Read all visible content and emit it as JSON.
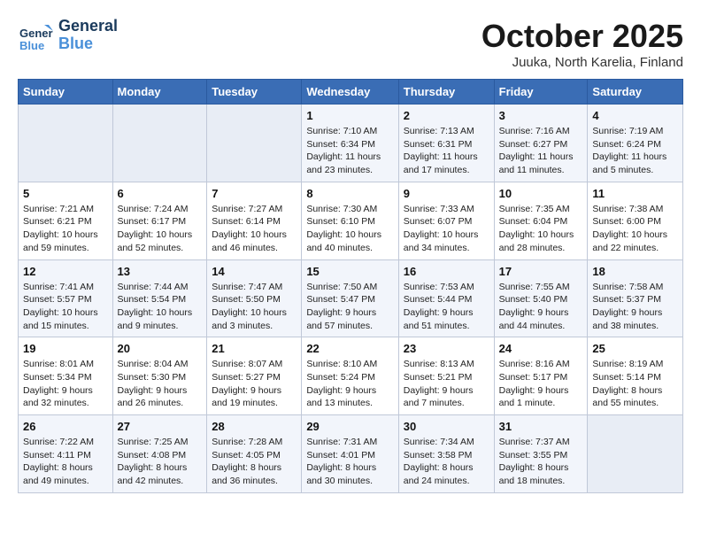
{
  "header": {
    "logo_line1": "General",
    "logo_line2": "Blue",
    "month": "October 2025",
    "location": "Juuka, North Karelia, Finland"
  },
  "days_of_week": [
    "Sunday",
    "Monday",
    "Tuesday",
    "Wednesday",
    "Thursday",
    "Friday",
    "Saturday"
  ],
  "weeks": [
    [
      {
        "day": "",
        "info": ""
      },
      {
        "day": "",
        "info": ""
      },
      {
        "day": "",
        "info": ""
      },
      {
        "day": "1",
        "info": "Sunrise: 7:10 AM\nSunset: 6:34 PM\nDaylight: 11 hours\nand 23 minutes."
      },
      {
        "day": "2",
        "info": "Sunrise: 7:13 AM\nSunset: 6:31 PM\nDaylight: 11 hours\nand 17 minutes."
      },
      {
        "day": "3",
        "info": "Sunrise: 7:16 AM\nSunset: 6:27 PM\nDaylight: 11 hours\nand 11 minutes."
      },
      {
        "day": "4",
        "info": "Sunrise: 7:19 AM\nSunset: 6:24 PM\nDaylight: 11 hours\nand 5 minutes."
      }
    ],
    [
      {
        "day": "5",
        "info": "Sunrise: 7:21 AM\nSunset: 6:21 PM\nDaylight: 10 hours\nand 59 minutes."
      },
      {
        "day": "6",
        "info": "Sunrise: 7:24 AM\nSunset: 6:17 PM\nDaylight: 10 hours\nand 52 minutes."
      },
      {
        "day": "7",
        "info": "Sunrise: 7:27 AM\nSunset: 6:14 PM\nDaylight: 10 hours\nand 46 minutes."
      },
      {
        "day": "8",
        "info": "Sunrise: 7:30 AM\nSunset: 6:10 PM\nDaylight: 10 hours\nand 40 minutes."
      },
      {
        "day": "9",
        "info": "Sunrise: 7:33 AM\nSunset: 6:07 PM\nDaylight: 10 hours\nand 34 minutes."
      },
      {
        "day": "10",
        "info": "Sunrise: 7:35 AM\nSunset: 6:04 PM\nDaylight: 10 hours\nand 28 minutes."
      },
      {
        "day": "11",
        "info": "Sunrise: 7:38 AM\nSunset: 6:00 PM\nDaylight: 10 hours\nand 22 minutes."
      }
    ],
    [
      {
        "day": "12",
        "info": "Sunrise: 7:41 AM\nSunset: 5:57 PM\nDaylight: 10 hours\nand 15 minutes."
      },
      {
        "day": "13",
        "info": "Sunrise: 7:44 AM\nSunset: 5:54 PM\nDaylight: 10 hours\nand 9 minutes."
      },
      {
        "day": "14",
        "info": "Sunrise: 7:47 AM\nSunset: 5:50 PM\nDaylight: 10 hours\nand 3 minutes."
      },
      {
        "day": "15",
        "info": "Sunrise: 7:50 AM\nSunset: 5:47 PM\nDaylight: 9 hours\nand 57 minutes."
      },
      {
        "day": "16",
        "info": "Sunrise: 7:53 AM\nSunset: 5:44 PM\nDaylight: 9 hours\nand 51 minutes."
      },
      {
        "day": "17",
        "info": "Sunrise: 7:55 AM\nSunset: 5:40 PM\nDaylight: 9 hours\nand 44 minutes."
      },
      {
        "day": "18",
        "info": "Sunrise: 7:58 AM\nSunset: 5:37 PM\nDaylight: 9 hours\nand 38 minutes."
      }
    ],
    [
      {
        "day": "19",
        "info": "Sunrise: 8:01 AM\nSunset: 5:34 PM\nDaylight: 9 hours\nand 32 minutes."
      },
      {
        "day": "20",
        "info": "Sunrise: 8:04 AM\nSunset: 5:30 PM\nDaylight: 9 hours\nand 26 minutes."
      },
      {
        "day": "21",
        "info": "Sunrise: 8:07 AM\nSunset: 5:27 PM\nDaylight: 9 hours\nand 19 minutes."
      },
      {
        "day": "22",
        "info": "Sunrise: 8:10 AM\nSunset: 5:24 PM\nDaylight: 9 hours\nand 13 minutes."
      },
      {
        "day": "23",
        "info": "Sunrise: 8:13 AM\nSunset: 5:21 PM\nDaylight: 9 hours\nand 7 minutes."
      },
      {
        "day": "24",
        "info": "Sunrise: 8:16 AM\nSunset: 5:17 PM\nDaylight: 9 hours\nand 1 minute."
      },
      {
        "day": "25",
        "info": "Sunrise: 8:19 AM\nSunset: 5:14 PM\nDaylight: 8 hours\nand 55 minutes."
      }
    ],
    [
      {
        "day": "26",
        "info": "Sunrise: 7:22 AM\nSunset: 4:11 PM\nDaylight: 8 hours\nand 49 minutes."
      },
      {
        "day": "27",
        "info": "Sunrise: 7:25 AM\nSunset: 4:08 PM\nDaylight: 8 hours\nand 42 minutes."
      },
      {
        "day": "28",
        "info": "Sunrise: 7:28 AM\nSunset: 4:05 PM\nDaylight: 8 hours\nand 36 minutes."
      },
      {
        "day": "29",
        "info": "Sunrise: 7:31 AM\nSunset: 4:01 PM\nDaylight: 8 hours\nand 30 minutes."
      },
      {
        "day": "30",
        "info": "Sunrise: 7:34 AM\nSunset: 3:58 PM\nDaylight: 8 hours\nand 24 minutes."
      },
      {
        "day": "31",
        "info": "Sunrise: 7:37 AM\nSunset: 3:55 PM\nDaylight: 8 hours\nand 18 minutes."
      },
      {
        "day": "",
        "info": ""
      }
    ]
  ]
}
